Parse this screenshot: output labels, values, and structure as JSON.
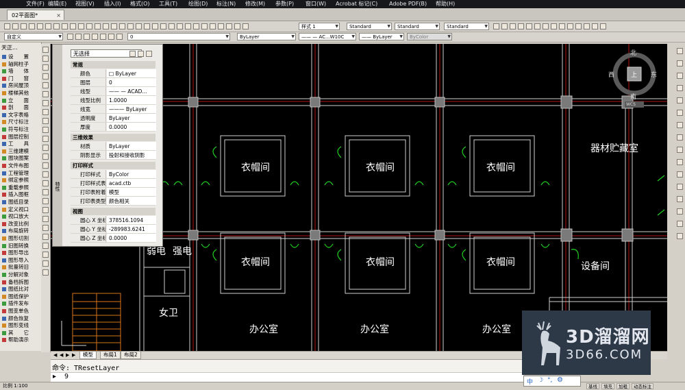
{
  "menubar": {
    "items": [
      "文件(F)",
      "编辑(E)",
      "视图(V)",
      "插入(I)",
      "格式(O)",
      "工具(T)",
      "绘图(D)",
      "标注(N)",
      "修改(M)",
      "参数(P)",
      "窗口(W)",
      "Acrobat 标记(C)",
      "Adobe PDF(B)",
      "帮助(H)"
    ]
  },
  "tabs": {
    "document": "02平面图*",
    "close": "×"
  },
  "toolbars": {
    "workspace": "自定义",
    "layer": "0",
    "color": "ByLayer",
    "text_style_label": "样式 1",
    "text_style": "Standard",
    "dim_style": "Standard",
    "table_style": "Standard",
    "linetype": "—— — AC...W10C",
    "lineweight": "—— ByLayer",
    "plotstyle": "ByColor"
  },
  "left_panel": {
    "title": "天正...",
    "items": [
      "设　　置",
      "轴网柱子",
      "墙　　体",
      "门　　窗",
      "房间屋顶",
      "楼梯其他",
      "立　　面",
      "剖　　面",
      "文字表格",
      "尺寸标注",
      "符号标注",
      "图层控制",
      "工　　具",
      "三维建模",
      "图块图案",
      "文件布图",
      "工程管理",
      "绑定参照",
      "重载参照",
      "插入图框",
      "图纸目录",
      "定义视口",
      "视口放大",
      "改变比例",
      "布局旋转",
      "图形切割",
      "旧图转换",
      "图形导出",
      "图形导入",
      "批量转旧",
      "分解对象",
      "备档拆图",
      "图纸比对",
      "图纸保护",
      "插件发布",
      "图变单色",
      "颜色恢复",
      "图形变线",
      "其　　它",
      "帮助演示"
    ]
  },
  "properties": {
    "selection": "无选择",
    "categories": {
      "general": "常规",
      "threed": "三维效果",
      "plot": "打印样式",
      "view": "视图"
    },
    "general_rows": [
      {
        "k": "颜色",
        "v": "□ ByLayer"
      },
      {
        "k": "图层",
        "v": "0"
      },
      {
        "k": "线型",
        "v": "—— — ACAD..."
      },
      {
        "k": "线型比例",
        "v": "1.0000"
      },
      {
        "k": "线宽",
        "v": "——— ByLayer"
      },
      {
        "k": "透明度",
        "v": "ByLayer"
      },
      {
        "k": "厚度",
        "v": "0.0000"
      }
    ],
    "threed_rows": [
      {
        "k": "材质",
        "v": "ByLayer"
      },
      {
        "k": "阴影显示",
        "v": "投射和接收阴影"
      }
    ],
    "plot_rows": [
      {
        "k": "打印样式",
        "v": "ByColor"
      },
      {
        "k": "打印样式表",
        "v": "acad.ctb"
      },
      {
        "k": "打印表附着到",
        "v": "模型"
      },
      {
        "k": "打印表类型",
        "v": "颜色相关"
      }
    ],
    "view_rows": [
      {
        "k": "圆心 X 坐标",
        "v": "378516.1094"
      },
      {
        "k": "圆心 Y 坐标",
        "v": "-289983.6241"
      },
      {
        "k": "圆心 Z 坐标",
        "v": "0.0000"
      }
    ],
    "side_label": "特性"
  },
  "drawing": {
    "rooms": {
      "cloakroom": "衣帽间",
      "storage": "器材贮藏室",
      "equipment": "设备间",
      "office": "办公室",
      "weak_elec": "弱电",
      "strong_elec": "强电",
      "womens_wc": "女卫"
    },
    "viewcube": {
      "north": "北",
      "south": "南",
      "east": "东",
      "west": "西",
      "top": "上",
      "wcs": "WCS"
    },
    "colors": {
      "wall": "#ffffff",
      "axis": "#c81818",
      "door": "#22d022",
      "column": "#7a7a7a",
      "stair": "#d8761b"
    }
  },
  "layout_tabs": [
    "模型",
    "布局1",
    "布局2"
  ],
  "command": {
    "history": "命令: TResetLayer",
    "prompt_icon": "▸",
    "input": "9"
  },
  "status": {
    "scale": "比例 1:100",
    "buttons": [
      "基线",
      "填充",
      "加粗",
      "动态标注"
    ]
  },
  "watermark": {
    "brand": "3D溜溜网",
    "url": "3D66.COM"
  },
  "ime": {
    "lang": "中"
  }
}
